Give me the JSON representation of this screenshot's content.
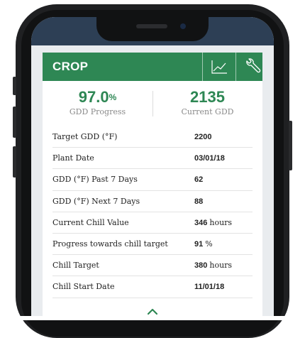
{
  "card": {
    "title": "CROP",
    "icons": [
      "line-chart-icon",
      "wrench-icon",
      "chevron-up-icon"
    ]
  },
  "stats": {
    "gdd_progress": {
      "value": "97.0",
      "unit": "%",
      "label": "GDD Progress"
    },
    "current_gdd": {
      "value": "2135",
      "label": "Current GDD"
    }
  },
  "rows": [
    {
      "label": "Target GDD (°F)",
      "value": "2200",
      "unit": ""
    },
    {
      "label": "Plant Date",
      "value": "03/01/18",
      "unit": ""
    },
    {
      "label": "GDD (°F) Past 7 Days",
      "value": "62",
      "unit": ""
    },
    {
      "label": "GDD (°F) Next 7 Days",
      "value": "88",
      "unit": ""
    },
    {
      "label": "Current Chill Value",
      "value": "346",
      "unit": "hours"
    },
    {
      "label": "Progress towards chill target",
      "value": "91",
      "unit": "%"
    },
    {
      "label": "Chill Target",
      "value": "380",
      "unit": "hours"
    },
    {
      "label": "Chill Start Date",
      "value": "11/01/18",
      "unit": ""
    }
  ],
  "colors": {
    "accent": "#2e8754",
    "status_bar": "#2d3f55",
    "phone": "#1f2022"
  }
}
